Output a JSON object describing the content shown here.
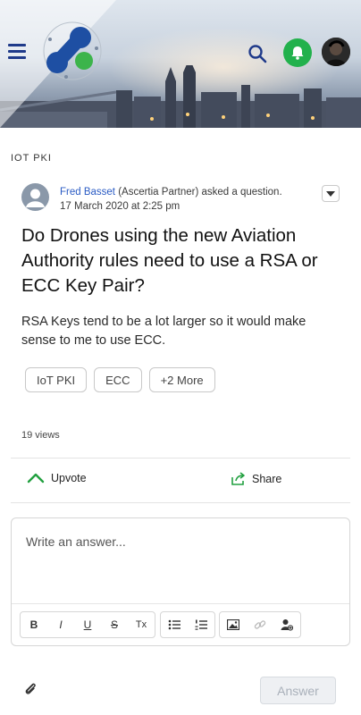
{
  "header": {
    "colors": {
      "menu": "#1f3a8a",
      "notification": "#22b14c",
      "search": "#1f3a8a"
    }
  },
  "question": {
    "category": "IOT PKI",
    "author_name": "Fred Basset",
    "author_role": "(Ascertia Partner) asked a question.",
    "date": "17 March 2020 at 2:25 pm",
    "title": "Do Drones using the new Aviation Authority rules need to use a RSA or ECC Key Pair?",
    "body": "RSA Keys tend to be a lot larger so it would make sense to me to use ECC.",
    "tags": [
      "IoT PKI",
      "ECC",
      "+2 More"
    ],
    "views": "19 views"
  },
  "actions": {
    "upvote_label": "Upvote",
    "share_label": "Share",
    "accent_color": "#22a040"
  },
  "editor": {
    "placeholder": "Write an answer...",
    "toolbar": {
      "bold": "B",
      "italic": "I",
      "underline": "U",
      "strikethrough": "S",
      "clear_format": "Tx"
    },
    "submit_label": "Answer"
  }
}
